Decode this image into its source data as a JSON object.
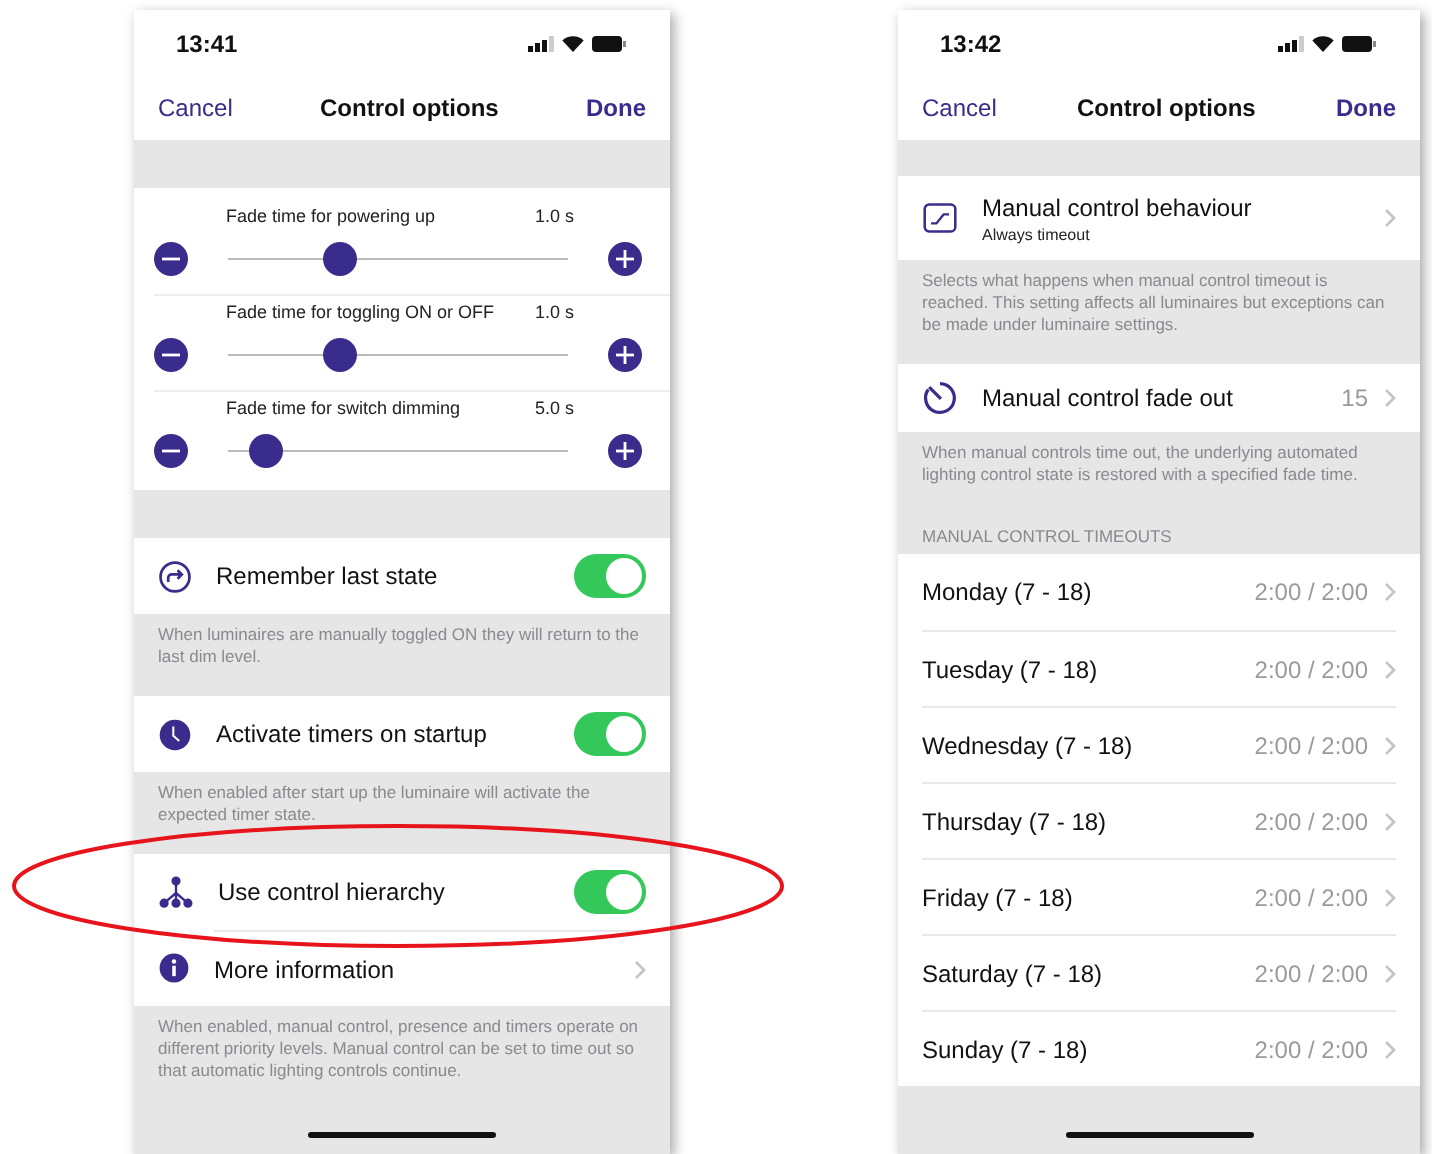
{
  "screens": [
    {
      "status_bar": {
        "time": "13:41"
      },
      "nav": {
        "cancel": "Cancel",
        "title": "Control options",
        "done": "Done"
      },
      "sections": [
        {
          "kind": "sliders",
          "sliders": [
            {
              "label": "Fade time for powering up",
              "reading": "1.0 s",
              "level": 0.33
            },
            {
              "label": "Fade time for toggling ON or OFF",
              "reading": "1.0 s",
              "level": 0.33
            },
            {
              "label": "Fade time for switch dimming",
              "reading": "5.0 s",
              "level": 0.11
            }
          ]
        },
        {
          "kind": "rows",
          "rows": [
            {
              "kind": "toggle",
              "label": "Remember last state",
              "on": true
            }
          ],
          "footer": "When luminaires are manually toggled ON they will return to the last dim level."
        },
        {
          "kind": "rows",
          "rows": [
            {
              "kind": "toggle",
              "label": "Activate timers on startup",
              "on": true
            }
          ],
          "footer": "When enabled after start up the luminaire will activate the expected timer state."
        },
        {
          "kind": "rows",
          "rows": [
            {
              "kind": "toggle",
              "label": "Use control hierarchy",
              "on": true,
              "highlighted": true
            },
            {
              "kind": "link",
              "label": "More information"
            }
          ],
          "footer": "When enabled, manual control, presence and timers operate on different priority levels. Manual control can be set to time out so that automatic lighting controls continue."
        }
      ]
    },
    {
      "status_bar": {
        "time": "13:42"
      },
      "nav": {
        "cancel": "Cancel",
        "title": "Control options",
        "done": "Done"
      },
      "sections": [
        {
          "kind": "rows",
          "rows": [
            {
              "kind": "link",
              "label": "Manual control behaviour",
              "sublabel": "Always timeout"
            }
          ],
          "footer": "Selects what happens when manual control timeout is reached. This setting affects all luminaires but exceptions can be made under luminaire settings."
        },
        {
          "kind": "rows",
          "rows": [
            {
              "kind": "link",
              "label": "Manual control fade out",
              "value": "15"
            }
          ],
          "footer": "When manual controls time out, the underlying automated lighting control state is restored with a specified fade time."
        },
        {
          "kind": "rows",
          "header": "MANUAL CONTROL TIMEOUTS",
          "rows": [
            {
              "kind": "link",
              "label": "Monday (7 - 18)",
              "value": "2:00 / 2:00"
            },
            {
              "kind": "link",
              "label": "Tuesday (7 - 18)",
              "value": "2:00 / 2:00"
            },
            {
              "kind": "link",
              "label": "Wednesday (7 - 18)",
              "value": "2:00 / 2:00"
            },
            {
              "kind": "link",
              "label": "Thursday (7 - 18)",
              "value": "2:00 / 2:00"
            },
            {
              "kind": "link",
              "label": "Friday (7 - 18)",
              "value": "2:00 / 2:00"
            },
            {
              "kind": "link",
              "label": "Saturday (7 - 18)",
              "value": "2:00 / 2:00"
            },
            {
              "kind": "link",
              "label": "Sunday (7 - 18)",
              "value": "2:00 / 2:00"
            }
          ]
        }
      ]
    }
  ]
}
